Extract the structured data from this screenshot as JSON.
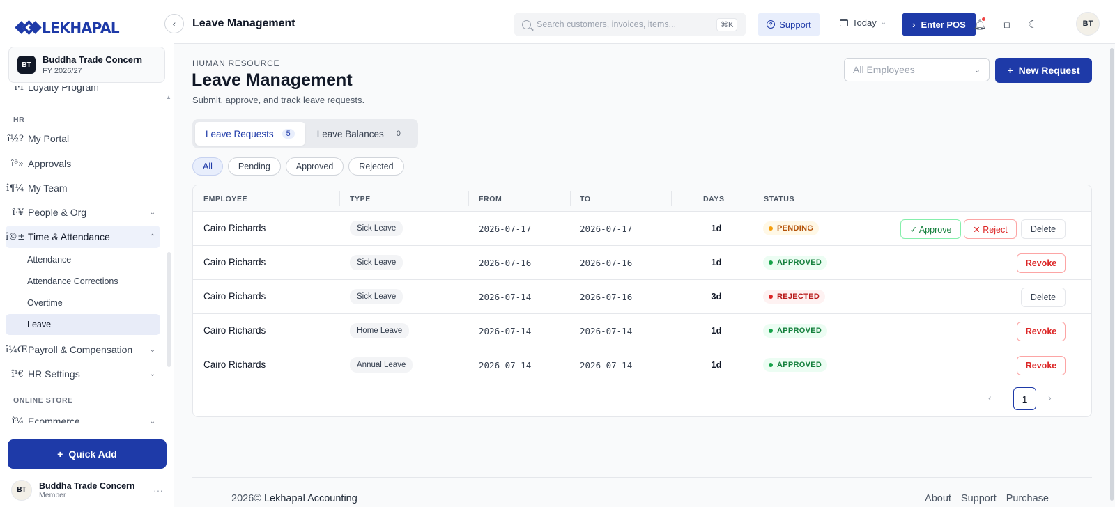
{
  "brand": {
    "name": "LEKHAPAL",
    "accent": "#1e3aa8"
  },
  "org": {
    "initials": "BT",
    "name": "Buddha Trade Concern",
    "fy": "FY 2026/27"
  },
  "sidebar": {
    "partial_item": {
      "icon": "ì·Ì",
      "label": "Loyalty Program"
    },
    "sections": {
      "hr": "HR",
      "online_store": "ONLINE STORE"
    },
    "items": [
      {
        "icon": "î½?",
        "label": "My Portal"
      },
      {
        "icon": "îª»",
        "label": "Approvals"
      },
      {
        "icon": "î¶¼",
        "label": "My Team"
      },
      {
        "icon": "î·¥",
        "label": "People & Org"
      },
      {
        "icon": "î©±",
        "label": "Time & Attendance"
      },
      {
        "icon": "î¼Œ",
        "label": "Payroll & Compensation"
      },
      {
        "icon": "î¹€",
        "label": "HR Settings"
      },
      {
        "icon": "î¾",
        "label": "Ecommerce"
      }
    ],
    "sub_items": [
      "Attendance",
      "Attendance Corrections",
      "Overtime",
      "Leave"
    ],
    "quick_add": "Quick Add",
    "user": {
      "initials": "BT",
      "name": "Buddha Trade Concern",
      "role": "Member",
      "more": "···"
    }
  },
  "header": {
    "title": "Leave Management",
    "search_placeholder": "Search customers, invoices, items...",
    "shortcut": "⌘K",
    "support": "Support",
    "date_label": "Today",
    "pos": "Enter POS",
    "avatar": "BT"
  },
  "page": {
    "eyebrow": "HUMAN RESOURCE",
    "title": "Leave Management",
    "subtitle": "Submit, approve, and track leave requests.",
    "employee_filter": "All Employees",
    "new_request": "New Request",
    "tabs": [
      {
        "label": "Leave Requests",
        "count": "5"
      },
      {
        "label": "Leave Balances",
        "count": "0"
      }
    ],
    "filters": [
      "All",
      "Pending",
      "Approved",
      "Rejected"
    ]
  },
  "table": {
    "columns": [
      "EMPLOYEE",
      "TYPE",
      "FROM",
      "TO",
      "DAYS",
      "STATUS"
    ],
    "rows": [
      {
        "employee": "Cairo Richards",
        "type": "Sick Leave",
        "from": "2026-07-17",
        "to": "2026-07-17",
        "days": "1d",
        "status": "PENDING"
      },
      {
        "employee": "Cairo Richards",
        "type": "Sick Leave",
        "from": "2026-07-16",
        "to": "2026-07-16",
        "days": "1d",
        "status": "APPROVED"
      },
      {
        "employee": "Cairo Richards",
        "type": "Sick Leave",
        "from": "2026-07-14",
        "to": "2026-07-16",
        "days": "3d",
        "status": "REJECTED"
      },
      {
        "employee": "Cairo Richards",
        "type": "Home Leave",
        "from": "2026-07-14",
        "to": "2026-07-14",
        "days": "1d",
        "status": "APPROVED"
      },
      {
        "employee": "Cairo Richards",
        "type": "Annual Leave",
        "from": "2026-07-14",
        "to": "2026-07-14",
        "days": "1d",
        "status": "APPROVED"
      }
    ],
    "actions": {
      "approve": "✓ Approve",
      "reject": "✕ Reject",
      "delete": "Delete",
      "revoke": "Revoke"
    },
    "page": "1"
  },
  "footer": {
    "year": "2026©",
    "company": "Lekhapal Accounting",
    "links": [
      "About",
      "Support",
      "Purchase"
    ]
  }
}
